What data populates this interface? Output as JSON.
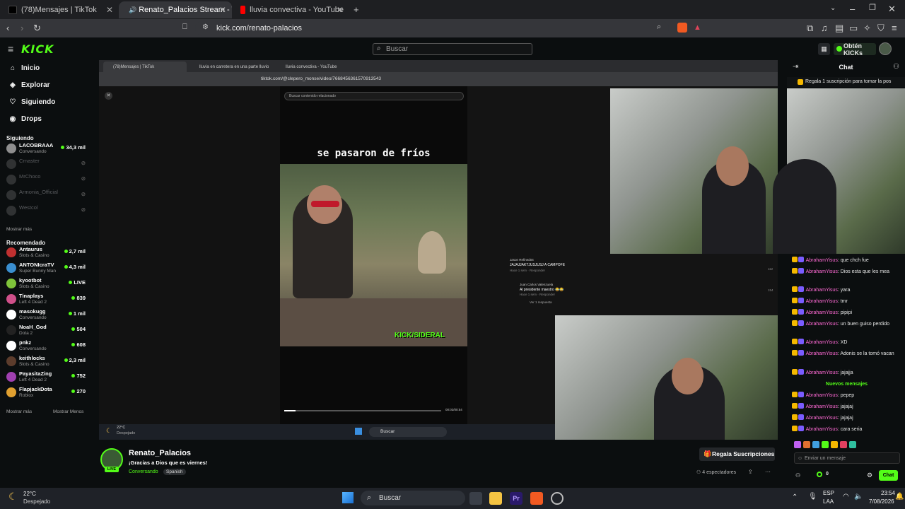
{
  "browser": {
    "tabs": [
      {
        "label": "(78)Mensajes | TikTok",
        "color": "#000000"
      },
      {
        "label": "Renato_Palacios Stream - Wa",
        "color": "#53fc18"
      },
      {
        "label": "lluvia convectiva - YouTube",
        "color": "#ff0000"
      }
    ],
    "url": "kick.com/renato-palacios"
  },
  "kick": {
    "logo": "KICK",
    "search_placeholder": "Buscar",
    "get_kicks": "Obtén KICKs",
    "nav": [
      {
        "label": "Inicio",
        "icon": "home-icon",
        "glyph": "⌂"
      },
      {
        "label": "Explorar",
        "icon": "compass-icon",
        "glyph": "◈"
      },
      {
        "label": "Siguiendo",
        "icon": "heart-icon",
        "glyph": "♡"
      },
      {
        "label": "Drops",
        "icon": "drop-icon",
        "glyph": "◉"
      }
    ],
    "following_title": "Siguiendo",
    "following": [
      {
        "name": "LACOBRAAA",
        "category": "Conversando",
        "viewers": "34,3 mil",
        "online": true,
        "color": "#8e8e8e"
      },
      {
        "name": "Crnaster",
        "category": "",
        "viewers": "",
        "online": false,
        "color": "#6a6a6a"
      },
      {
        "name": "MrChoco",
        "category": "",
        "viewers": "",
        "online": false,
        "color": "#6a6a6a"
      },
      {
        "name": "Armonia_Official",
        "category": "",
        "viewers": "",
        "online": false,
        "color": "#6a6a6a"
      },
      {
        "name": "Westcol",
        "category": "",
        "viewers": "",
        "online": false,
        "color": "#6a6a6a"
      }
    ],
    "show_more": "Mostrar más",
    "recommended_title": "Recomendado",
    "recommended": [
      {
        "name": "Antaurus",
        "category": "Slots & Casino",
        "viewers": "2,7 mil",
        "color": "#c03030"
      },
      {
        "name": "ANTONIcraTV",
        "category": "Super Bunny Man",
        "viewers": "4,3 mil",
        "color": "#3a8fd0"
      },
      {
        "name": "kyootbot",
        "category": "Slots & Casino",
        "viewers": "LIVE",
        "color": "#7fc43a"
      },
      {
        "name": "Tinaplays",
        "category": "Left 4 Dead 2",
        "viewers": "839",
        "color": "#d0508a"
      },
      {
        "name": "masokugg",
        "category": "Conversando",
        "viewers": "1 mil",
        "color": "#ffffff"
      },
      {
        "name": "NoaH_God",
        "category": "Dota 2",
        "viewers": "504",
        "color": "#222222"
      },
      {
        "name": "pnkz",
        "category": "Conversando",
        "viewers": "608",
        "color": "#ffffff"
      },
      {
        "name": "keithlocks",
        "category": "Slots & Casino",
        "viewers": "2,3 mil",
        "color": "#5c3c2c"
      },
      {
        "name": "PayasitaZing",
        "category": "Left 4 Dead 2",
        "viewers": "752",
        "color": "#a040b0"
      },
      {
        "name": "FlapjackDota",
        "category": "Roblox",
        "viewers": "270",
        "color": "#e0a030"
      }
    ],
    "show_more_2": "Mostrar más",
    "show_less": "Mostrar Menos"
  },
  "video": {
    "inner_tabs": [
      "(78)Mensajes | TikTok",
      "lluvia en carretera en una parte lluvio",
      "lluvia convectiva - YouTube"
    ],
    "inner_url": "tiktok.com/@clepero_monse/video/7668456361570913543",
    "tiktok_search": "Buscar contenido relacionado",
    "caption": "se pasaron de fríos",
    "watermark": "KICK/SIDERAL",
    "time": "00:02/00:54",
    "comments": [
      {
        "user": "Jason Refined04",
        "text": "JAJAJJAKTJUSJUSJ A CAMPOFE",
        "meta": "Hace 1 sem · Responder",
        "likes": "112"
      },
      {
        "user": "Juan Carlos Valenzuela",
        "text": "Al presidente maestro 😂😂",
        "meta": "Hace 1 sem · Responder",
        "likes": "154"
      }
    ],
    "replies": "Ver 1 respuesta",
    "inner_weather_temp": "22°C",
    "inner_weather_desc": "Despejado",
    "inner_search": "Buscar"
  },
  "chat": {
    "title": "Chat",
    "pinned": "Regala 1 suscripción para tomar la pos",
    "messages": [
      {
        "user": "AbrahamYisus",
        "text": "que chch fue"
      },
      {
        "user": "AbrahamYisus",
        "text": "Dios esta que les mea"
      },
      {
        "user": "AbrahamYisus",
        "text": "yara"
      },
      {
        "user": "AbrahamYisus",
        "text": "tmr"
      },
      {
        "user": "AbrahamYisus",
        "text": "pipipi"
      },
      {
        "user": "AbrahamYisus",
        "text": "un buen guiso perdido"
      },
      {
        "user": "AbrahamYisus",
        "text": "XD"
      },
      {
        "user": "AbrahamYisus",
        "text": "Adonis se la tomó vacan"
      },
      {
        "user": "AbrahamYisus",
        "text": "jajajja"
      }
    ],
    "new_messages": "Nuevos mensajes",
    "new": [
      {
        "user": "AbrahamYisus",
        "text": "pepep"
      },
      {
        "user": "AbrahamYisus",
        "text": "jajajaj"
      },
      {
        "user": "AbrahamYisus",
        "text": "jajajaj"
      },
      {
        "user": "AbrahamYisus",
        "text": "cara seria"
      }
    ],
    "input_placeholder": "Enviar un mensaje",
    "kicks_count": "0",
    "send_label": "Chat"
  },
  "streamer": {
    "name": "Renato_Palacios",
    "title": "¡Gracias a Dios que es viernes!",
    "category": "Conversando",
    "tag": "Spanish",
    "live": "LIVE",
    "gift_label": "Regala Suscripciones",
    "viewers": "4 espectadores"
  },
  "taskbar": {
    "temp": "22°C",
    "weather": "Despejado",
    "search": "Buscar",
    "lang1": "ESP",
    "lang2": "LAA",
    "time": "23:54",
    "date": "7/08/2026"
  }
}
